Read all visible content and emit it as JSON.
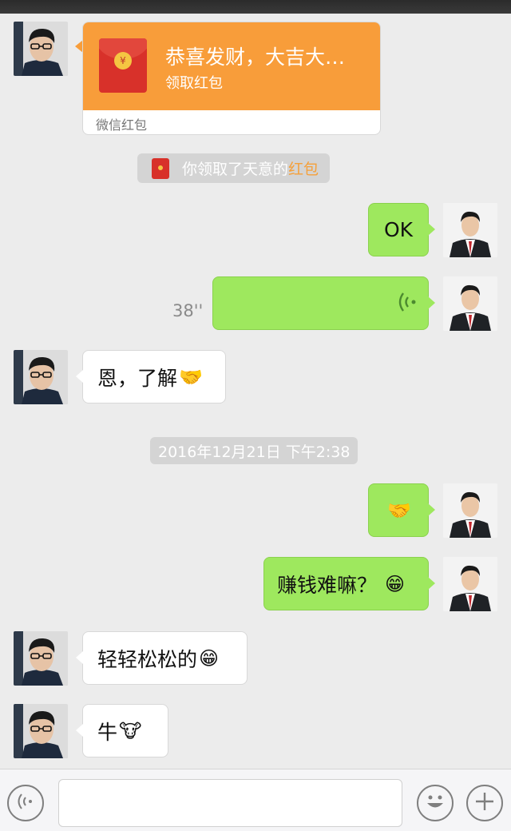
{
  "red_packet": {
    "title": "恭喜发财，大吉大…",
    "subtitle": "领取红包",
    "footer": "微信红包",
    "coin_symbol": "¥"
  },
  "system_notice": {
    "prefix": "你领取了天意的",
    "highlight": "红包",
    "highlight_color": "#f5a03a"
  },
  "messages": {
    "ok": "OK",
    "voice_duration": "38''",
    "understood": "恩，了解",
    "handshake_emoji": "🤝",
    "question": "赚钱难嘛？",
    "grin_emoji": "😁",
    "easy": "轻轻松松的",
    "niu": "牛",
    "cow_emoji": "🐮"
  },
  "timestamp": "2016年12月21日 下午2:38",
  "colors": {
    "outgoing_bubble": "#9ee85e",
    "incoming_bubble": "#ffffff",
    "red_packet": "#f89d3a",
    "background": "#ececec"
  },
  "input_bar": {
    "voice_icon": "voice-icon",
    "emoji_icon": "emoji-icon",
    "plus_icon": "plus-icon"
  }
}
